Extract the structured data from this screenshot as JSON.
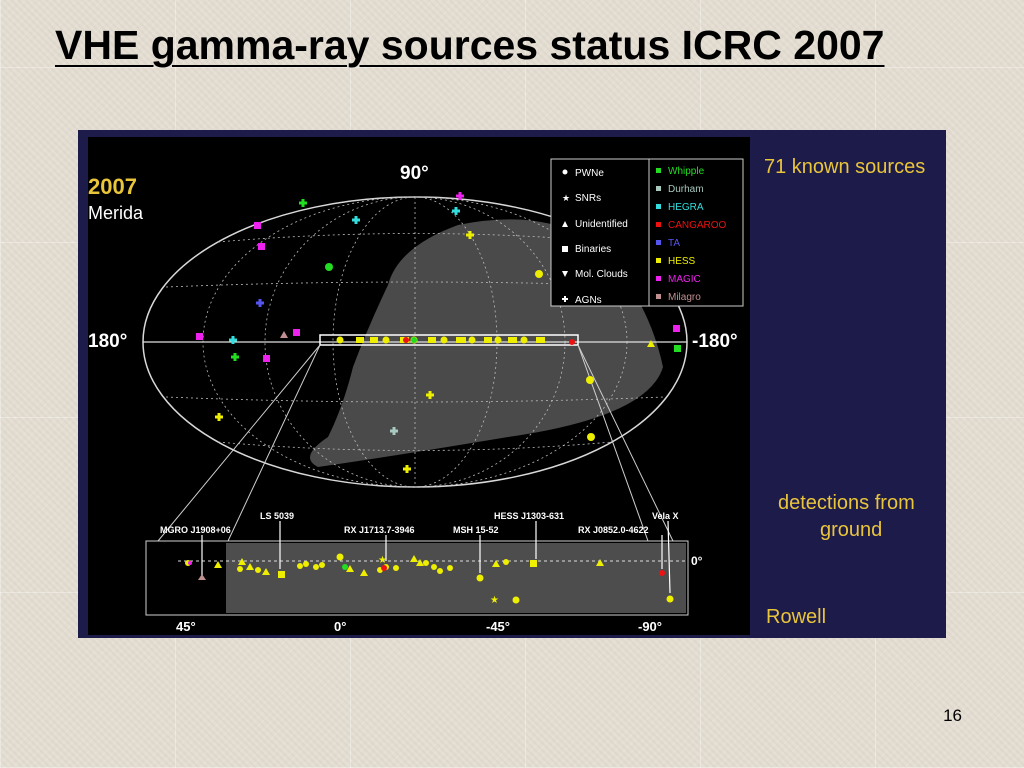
{
  "slide": {
    "title": "VHE gamma-ray sources status ICRC 2007",
    "slide_number": "16"
  },
  "figure": {
    "year": "2007",
    "location": "Merida",
    "known_sources": "71 known sources",
    "detections_line1": "detections from",
    "detections_line2": "ground",
    "credit": "Rowell",
    "axis_top": "90°",
    "axis_left": "180°",
    "axis_right": "-180°",
    "legend": {
      "types": [
        "PWNe",
        "SNRs",
        "Unidentified",
        "Binaries",
        "Mol. Clouds",
        "AGNs"
      ],
      "experiments": [
        {
          "name": "Whipple",
          "color": "#22dd22"
        },
        {
          "name": "Durham",
          "color": "#a8c8c0"
        },
        {
          "name": "HEGRA",
          "color": "#33dddd"
        },
        {
          "name": "CANGAROO",
          "color": "#ee1111"
        },
        {
          "name": "TA",
          "color": "#5555ee"
        },
        {
          "name": "HESS",
          "color": "#eeee00"
        },
        {
          "name": "MAGIC",
          "color": "#ee22ee"
        },
        {
          "name": "Milagro",
          "color": "#c09090"
        }
      ]
    },
    "plane_labels": [
      "MGRO J1908+06",
      "LS 5039",
      "RX J1713.7-3946",
      "MSH 15-52",
      "HESS J1303-631",
      "RX J0852.0-4622",
      "Vela X"
    ],
    "plane_ticks": [
      "45°",
      "0°",
      "-45°",
      "-90°"
    ],
    "plane_zero": "0°"
  },
  "colors": {
    "figure_bg": "#1d1b4a",
    "accent_text": "#e9c53a",
    "hess": "#eeee00",
    "whipple": "#22dd22",
    "magic": "#ee22ee",
    "hegra": "#33dddd",
    "cangaroo": "#ee1111",
    "ta": "#5555ee",
    "durham": "#a8c8c0",
    "milagro": "#c09090"
  }
}
